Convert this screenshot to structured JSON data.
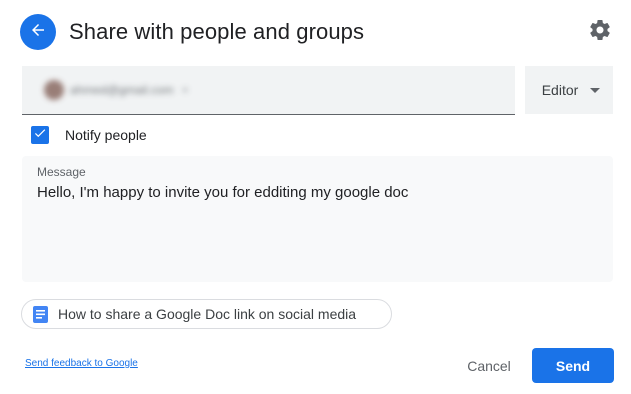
{
  "header": {
    "title": "Share with people and groups",
    "back_icon": "arrow-left-icon",
    "settings_icon": "gear-icon"
  },
  "recipients": {
    "chip_text": "ahmed@gmail.com",
    "chip_remove": "×"
  },
  "role": {
    "selected": "Editor"
  },
  "notify": {
    "label": "Notify people",
    "checked": true
  },
  "message": {
    "label": "Message",
    "value": "Hello, I'm happy to invite you for edditing my google doc"
  },
  "help": {
    "label": "How to share a Google Doc link on social media",
    "icon": "document-icon"
  },
  "footer": {
    "feedback_link": "Send feedback to Google",
    "cancel_label": "Cancel",
    "send_label": "Send"
  },
  "colors": {
    "accent": "#1a73e8",
    "field_background": "#f1f3f4",
    "message_background": "#f8f9fa"
  }
}
